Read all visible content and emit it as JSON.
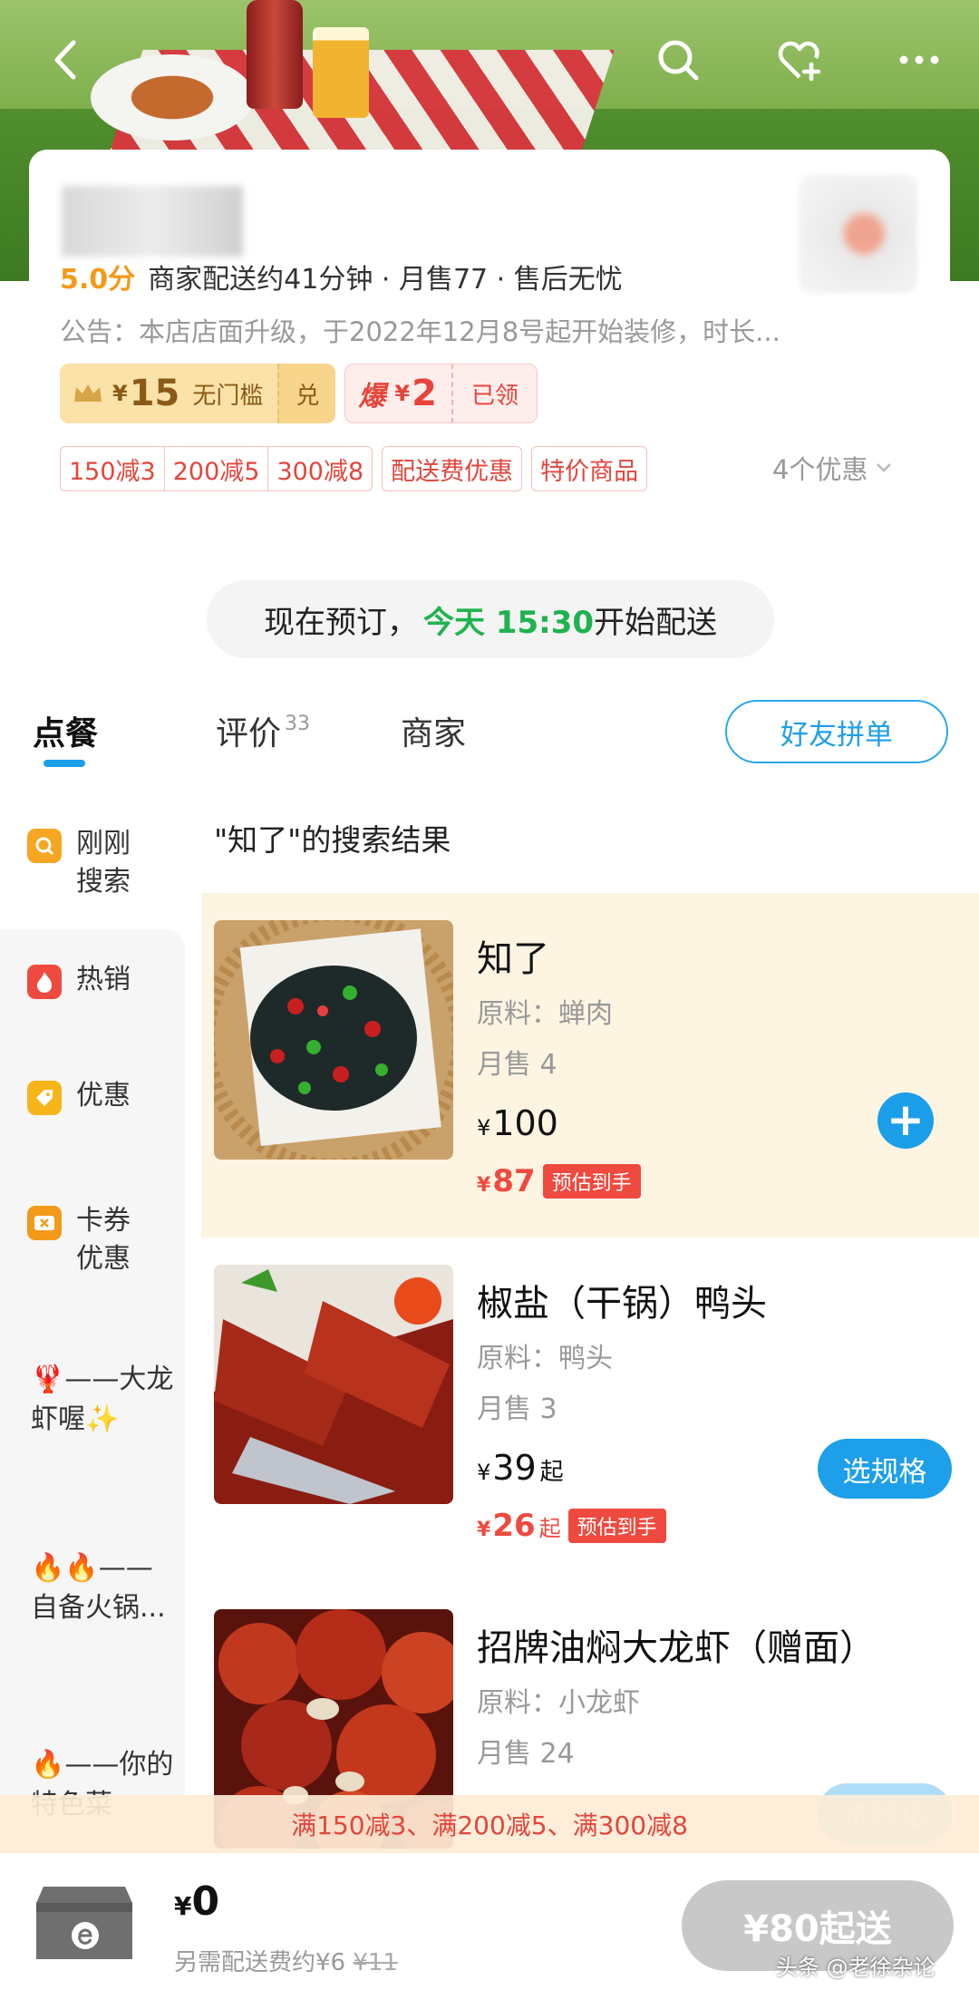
{
  "header": {
    "back_icon": "back-arrow-icon",
    "search_icon": "search-icon",
    "favorite_icon": "heart-plus-icon",
    "more_icon": "more-dots-icon"
  },
  "store": {
    "score": "5.0分",
    "delivery_info": "商家配送约41分钟 · 月售77 · 售后无忧",
    "notice": "公告：本店店面升级，于2022年12月8号起开始装修，时长...",
    "coupons": [
      {
        "yen": "¥",
        "amount": "15",
        "condition": "无门槛",
        "action": "兑"
      },
      {
        "tag": "爆",
        "yen": "¥",
        "amount": "2",
        "action": "已领"
      }
    ],
    "promos": [
      "150减3",
      "200减5",
      "300减8"
    ],
    "promo_delivery": "配送费优惠",
    "promo_special": "特价商品",
    "more_promos": "4个优惠"
  },
  "preorder": {
    "prefix": "现在预订，",
    "highlight": "今天 15:30",
    "suffix": "开始配送"
  },
  "tabs": {
    "order": "点餐",
    "reviews": "评价",
    "reviews_count": "33",
    "merchant": "商家",
    "group_order": "好友拼单"
  },
  "sidebar": {
    "recent": "刚刚搜索",
    "hot": "热销",
    "discount": "优惠",
    "vouchers": "卡券优惠",
    "crayfish": "🦞——大龙虾喔✨",
    "hotpot": "🔥🔥——自备火锅...",
    "special": "🔥——你的特色菜"
  },
  "results_title": "\"知了\"的搜索结果",
  "dishes": [
    {
      "name": "知了",
      "ingredient": "原料：蝉肉",
      "sales": "月售 4",
      "yen": "¥",
      "price": "100",
      "price_suffix": "",
      "est_price": "87",
      "est_suffix": "",
      "est_label": "预估到手"
    },
    {
      "name": "椒盐（干锅）鸭头",
      "ingredient": "原料：鸭头",
      "sales": "月售 3",
      "yen": "¥",
      "price": "39",
      "price_suffix": "起",
      "est_price": "26",
      "est_suffix": "起",
      "est_label": "预估到手",
      "button": "选规格"
    },
    {
      "name": "招牌油焖大龙虾（赠面）",
      "ingredient": "原料：小龙虾",
      "sales": "月售 24",
      "button": "选规格"
    }
  ],
  "promo_strip": "满150减3、满200减5、满300减8",
  "cart": {
    "yen": "¥",
    "total": "0",
    "fee_label": "另需配送费约¥6",
    "fee_original": "¥11",
    "min_order": "¥80起送"
  },
  "watermark": "头条 @老徐杂论",
  "colors": {
    "accent_blue": "#1a9fe8",
    "price_red": "#ef4a3f",
    "green": "#1fb34f",
    "gold": "#8a5a16"
  }
}
